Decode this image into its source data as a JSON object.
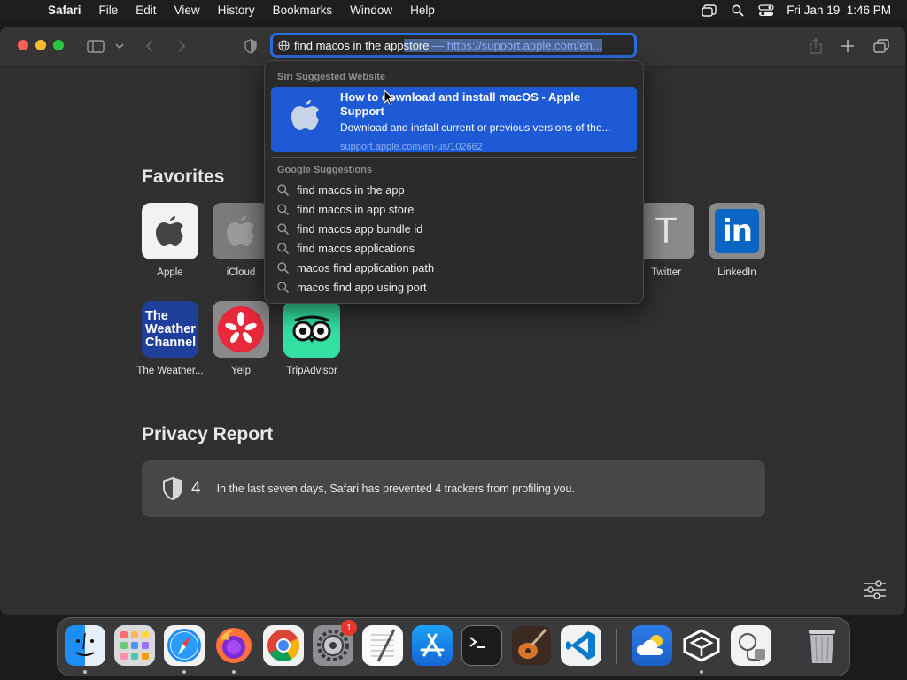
{
  "menubar": {
    "app": "Safari",
    "items": [
      "File",
      "Edit",
      "View",
      "History",
      "Bookmarks",
      "Window",
      "Help"
    ],
    "clock": "Fri Jan 19  1:46 PM"
  },
  "urlbar": {
    "typed": "find macos in the app",
    "completion": " store",
    "url_hint": " — https://support.apple.com/en..."
  },
  "dropdown": {
    "siri_header": "Siri Suggested Website",
    "siri_title": "How to download and install macOS - Apple Support",
    "siri_desc": "Download and install current or previous versions of the...",
    "siri_url": "support.apple.com/en-us/102662",
    "google_header": "Google Suggestions",
    "suggestions": [
      "find macos in the app",
      "find macos in app store",
      "find macos app bundle id",
      "find macos applications",
      "macos find application path",
      "macos find app using port"
    ]
  },
  "favorites": {
    "title": "Favorites",
    "items": [
      "Apple",
      "iCloud",
      "Twitter",
      "LinkedIn",
      "The Weather...",
      "Yelp",
      "TripAdvisor"
    ],
    "weather_tile": "The Weather Channel"
  },
  "privacy": {
    "title": "Privacy Report",
    "count": "4",
    "text": "In the last seven days, Safari has prevented 4 trackers from profiling you."
  },
  "dock": {
    "settings_badge": "1"
  },
  "colors": {
    "accent": "#2c6fe3",
    "selection": "#1f5ad6"
  }
}
